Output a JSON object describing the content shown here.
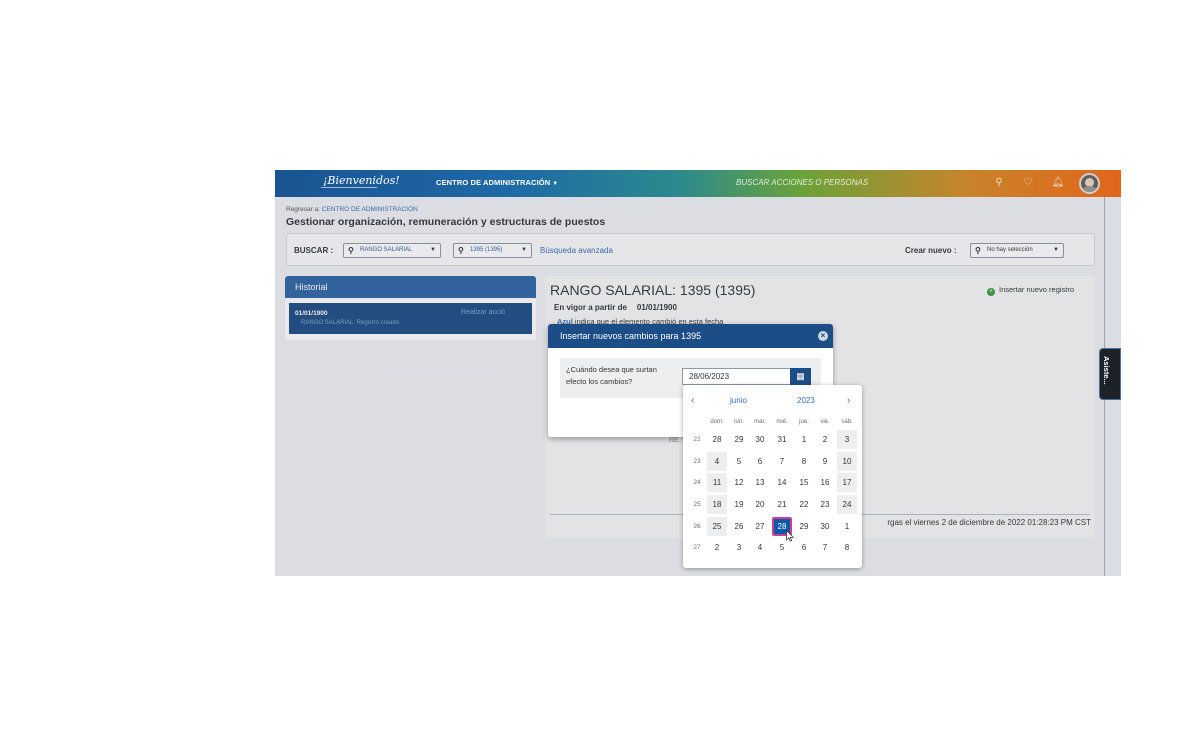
{
  "header": {
    "logo": "¡Bienvenidos!",
    "admin_menu": "CENTRO DE ADMINISTRACIÓN",
    "search_placeholder": "BUSCAR ACCIONES O PERSONAS"
  },
  "breadcrumb": {
    "prefix": "Regresar a: ",
    "link": "CENTRO DE ADMINISTRACIÓN"
  },
  "page_title": "Gestionar organización, remuneración y estructuras de puestos",
  "search_bar": {
    "label": "BUSCAR :",
    "type_select": "RANGO SALARIAL",
    "value_select": "1395 (1395)",
    "advanced_link": "Búsqueda avanzada",
    "create_label": "Crear nuevo :",
    "create_select": "No hay selección"
  },
  "history": {
    "title": "Historial",
    "row_date": "01/01/1900",
    "row_action": "Realizar acció",
    "row_sub": "RANGO SALARIAL: Registro creado"
  },
  "detail": {
    "title": "RANGO SALARIAL: 1395 (1395)",
    "insert_new": "Insertar nuevo registro",
    "vigor_label": "En vigor a partir de",
    "vigor_date": "01/01/1900",
    "azul_word": "Azul",
    "azul_note": " indica que el elemento cambió en esta fecha",
    "res_label": "RE",
    "load_info": "rgas el viernes 2 de diciembre de 2022 01:28:23 PM CST"
  },
  "asiste_tab": "Asiste...",
  "dialog": {
    "title": "Insertar nuevos cambios para 1395",
    "question_line1": "¿Cuándo desea que surtan",
    "question_line2": "efecto los cambios?",
    "date_value": "28/06/2023"
  },
  "calendar": {
    "month": "junio",
    "year": "2023",
    "weekdays": [
      "dom.",
      "lun.",
      "mar.",
      "mié.",
      "jue.",
      "vie.",
      "sáb."
    ],
    "weeks": [
      {
        "num": "22",
        "days": [
          "28",
          "29",
          "30",
          "31",
          "1",
          "2",
          "3"
        ]
      },
      {
        "num": "23",
        "days": [
          "4",
          "5",
          "6",
          "7",
          "8",
          "9",
          "10"
        ]
      },
      {
        "num": "24",
        "days": [
          "11",
          "12",
          "13",
          "14",
          "15",
          "16",
          "17"
        ]
      },
      {
        "num": "25",
        "days": [
          "18",
          "19",
          "20",
          "21",
          "22",
          "23",
          "24"
        ]
      },
      {
        "num": "26",
        "days": [
          "25",
          "26",
          "27",
          "28",
          "29",
          "30",
          "1"
        ]
      },
      {
        "num": "27",
        "days": [
          "2",
          "3",
          "4",
          "5",
          "6",
          "7",
          "8"
        ]
      }
    ],
    "selected_day": "28"
  },
  "colors": {
    "primary": "#1c4d86",
    "selected": "#0a5aa8",
    "focus_ring": "#d13c9a",
    "link": "#3b6db3"
  }
}
